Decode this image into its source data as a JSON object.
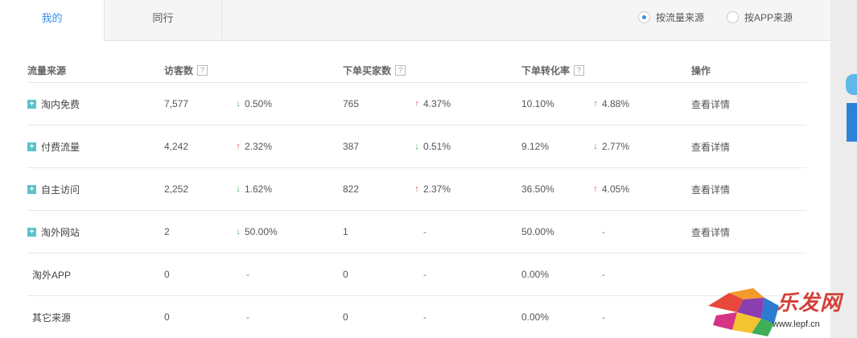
{
  "tabs": [
    {
      "label": "我的",
      "active": true
    },
    {
      "label": "同行",
      "active": false
    }
  ],
  "radios": [
    {
      "label": "按流量来源",
      "checked": true
    },
    {
      "label": "按APP来源",
      "checked": false
    }
  ],
  "table": {
    "headers": {
      "source": "流量来源",
      "visitors": "访客数",
      "buyers": "下单买家数",
      "conversion": "下单转化率",
      "action": "操作",
      "help_mark": "?"
    },
    "rows": [
      {
        "expand": "+",
        "source": "淘内免费",
        "visitors": "7,577",
        "visitors_trend": "down",
        "visitors_change": "0.50%",
        "buyers": "765",
        "buyers_trend": "up",
        "buyers_change": "4.37%",
        "conversion": "10.10%",
        "conversion_trend": "up",
        "conversion_change": "4.88%",
        "action": "查看详情"
      },
      {
        "expand": "+",
        "source": "付费流量",
        "visitors": "4,242",
        "visitors_trend": "up",
        "visitors_change": "2.32%",
        "buyers": "387",
        "buyers_trend": "down",
        "buyers_change": "0.51%",
        "conversion": "9.12%",
        "conversion_trend": "down",
        "conversion_change": "2.77%",
        "action": "查看详情"
      },
      {
        "expand": "+",
        "source": "自主访问",
        "visitors": "2,252",
        "visitors_trend": "down",
        "visitors_change": "1.62%",
        "buyers": "822",
        "buyers_trend": "up",
        "buyers_change": "2.37%",
        "conversion": "36.50%",
        "conversion_trend": "up",
        "conversion_change": "4.05%",
        "action": "查看详情"
      },
      {
        "expand": "+",
        "source": "淘外网站",
        "visitors": "2",
        "visitors_trend": "down",
        "visitors_change": "50.00%",
        "buyers": "1",
        "buyers_change": "-",
        "conversion": "50.00%",
        "conversion_change": "-",
        "action": "查看详情"
      },
      {
        "source": "淘外APP",
        "visitors": "0",
        "visitors_change": "-",
        "buyers": "0",
        "buyers_change": "-",
        "conversion": "0.00%",
        "conversion_change": "-"
      },
      {
        "source": "其它来源",
        "visitors": "0",
        "visitors_change": "-",
        "buyers": "0",
        "buyers_change": "-",
        "conversion": "0.00%",
        "conversion_change": "-"
      }
    ]
  },
  "arrows": {
    "up": "↑",
    "down": "↓"
  },
  "colors": {
    "accent": "#3a8ee6",
    "up": "#e05a4f",
    "down": "#3aa845",
    "expand": "#5cc1c9"
  },
  "watermark": {
    "text": "乐发网",
    "url": "www.lepf.cn"
  }
}
